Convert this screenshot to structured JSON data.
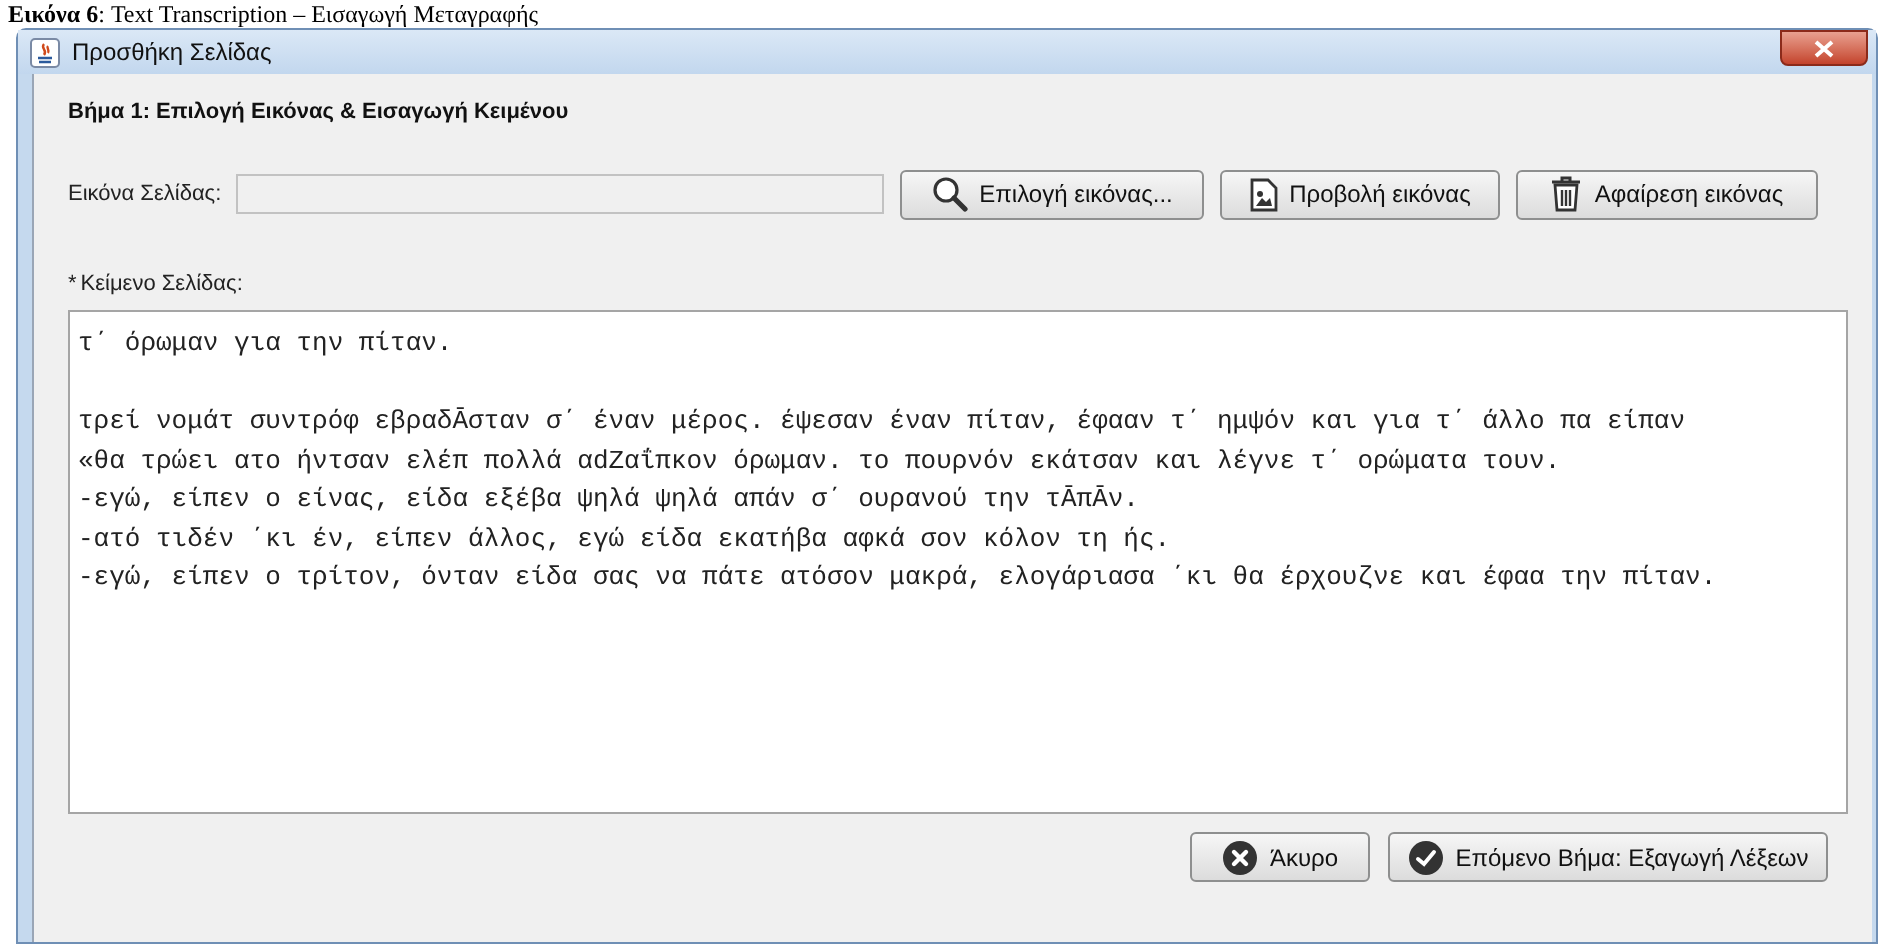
{
  "caption": {
    "label": "Εικόνα 6",
    "text": ": Text Transcription – Εισαγωγή Μεταγραφής"
  },
  "window": {
    "title": "Προσθήκη Σελίδας"
  },
  "step_title": "Βήμα 1: Επιλογή Εικόνας & Εισαγωγή Κειμένου",
  "image_field": {
    "label": "Εικόνα Σελίδας:"
  },
  "image_buttons": [
    {
      "label": "Επιλογή εικόνας...",
      "kind": "search"
    },
    {
      "label": "Προβολή εικόνας",
      "kind": "view"
    },
    {
      "label": "Αφαίρεση εικόνας",
      "kind": "remove"
    }
  ],
  "text_label": {
    "required_mark": "*",
    "label": "Κείμενο Σελίδας:"
  },
  "text_area": {
    "value": "τ΄ όρωμαν για την πίταν.\n\nτρεί νομάτ συντρόφ εβραδᾹσταν σ΄ έναν μέρος. έψεσαν έναν πίταν, έφααν τ΄ ημψόν και για τ΄ άλλο πα είπαν\n«θα τρώει ατο ήντσαν ελέπ πολλά αdΖαΐπκον όρωμαν. το πουρνόν εκάτσαν και λέγνε τ΄ ορώματα τουν.\n-εγώ, είπεν ο είνας, είδα εξέβα ψηλά ψηλά απάν σ΄ ουρανού την τᾹπᾹν.\n-ατό τιδέν ΄κι έν, είπεν άλλος, εγώ είδα εκατήβα αφκά σον κόλον τη ής.\n-εγώ, είπεν ο τρίτον, όνταν είδα σας να πάτε ατόσον μακρά, ελογάριασα ΄κι θα έρχουζνε και έφαα την πίταν."
  },
  "footer_buttons": [
    {
      "label": "Άκυρο",
      "kind": "cancel"
    },
    {
      "label": "Επόμενο Βήμα: Εξαγωγή Λέξεων",
      "kind": "next"
    }
  ]
}
